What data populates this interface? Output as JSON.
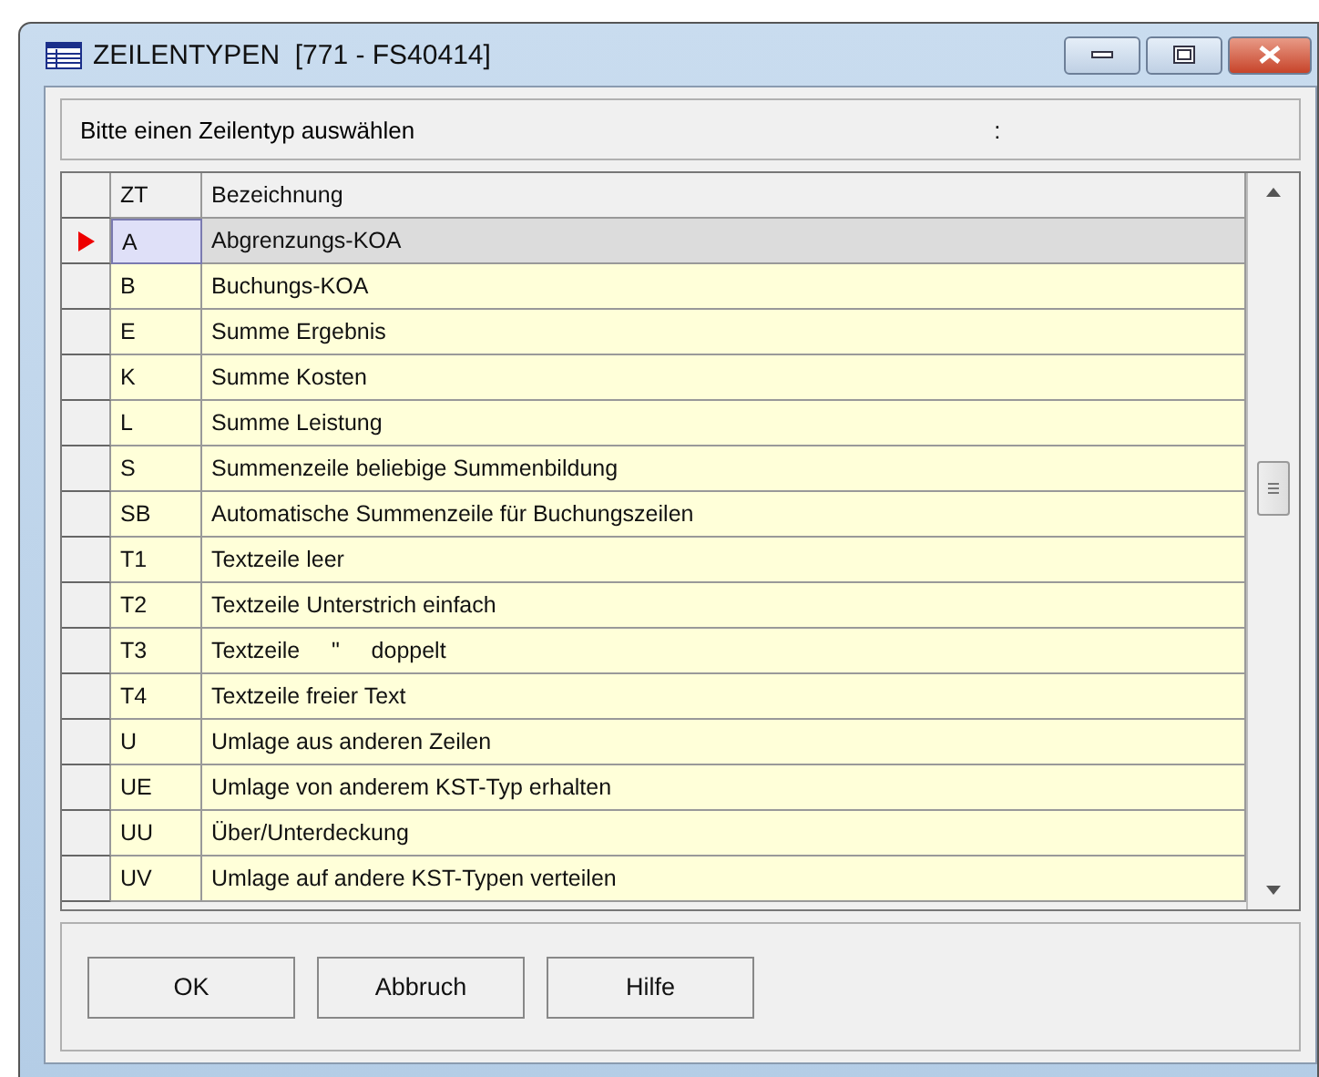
{
  "window": {
    "title": "ZEILENTYPEN  [771 - FS40414]"
  },
  "prompt": {
    "text": "Bitte einen Zeilentyp auswählen",
    "suffix": ":"
  },
  "table": {
    "columns": [
      "ZT",
      "Bezeichnung"
    ],
    "rows": [
      {
        "zt": "A",
        "bezeichnung": "Abgrenzungs-KOA",
        "selected": true
      },
      {
        "zt": "B",
        "bezeichnung": "Buchungs-KOA",
        "selected": false
      },
      {
        "zt": "E",
        "bezeichnung": "Summe Ergebnis",
        "selected": false
      },
      {
        "zt": "K",
        "bezeichnung": "Summe Kosten",
        "selected": false
      },
      {
        "zt": "L",
        "bezeichnung": "Summe Leistung",
        "selected": false
      },
      {
        "zt": "S",
        "bezeichnung": "Summenzeile beliebige Summenbildung",
        "selected": false
      },
      {
        "zt": "SB",
        "bezeichnung": "Automatische Summenzeile für Buchungszeilen",
        "selected": false
      },
      {
        "zt": "T1",
        "bezeichnung": "Textzeile leer",
        "selected": false
      },
      {
        "zt": "T2",
        "bezeichnung": "Textzeile Unterstrich einfach",
        "selected": false
      },
      {
        "zt": "T3",
        "bezeichnung": "Textzeile     \"     doppelt",
        "selected": false
      },
      {
        "zt": "T4",
        "bezeichnung": "Textzeile freier Text",
        "selected": false
      },
      {
        "zt": "U",
        "bezeichnung": "Umlage aus anderen Zeilen",
        "selected": false
      },
      {
        "zt": "UE",
        "bezeichnung": "Umlage von anderem KST-Typ erhalten",
        "selected": false
      },
      {
        "zt": "UU",
        "bezeichnung": "Über/Unterdeckung",
        "selected": false
      },
      {
        "zt": "UV",
        "bezeichnung": "Umlage auf andere KST-Typen verteilen",
        "selected": false
      }
    ]
  },
  "buttons": [
    "OK",
    "Abbruch",
    "Hilfe"
  ]
}
